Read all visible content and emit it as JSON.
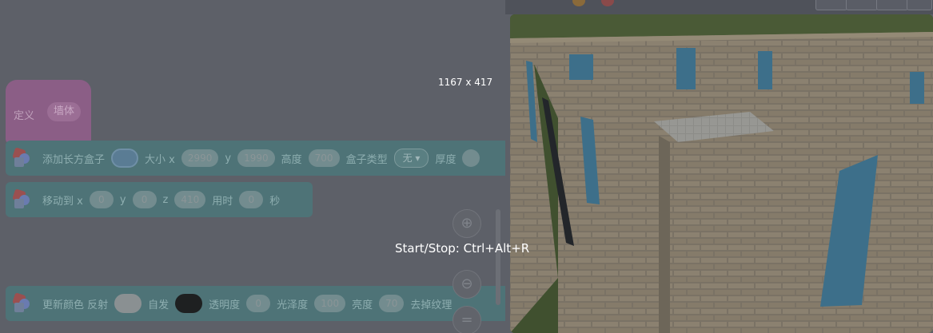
{
  "overlay": {
    "size_label": "1167 x 417",
    "hint_label": "Start/Stop: Ctrl+Alt+R"
  },
  "define_block": {
    "keyword": "定义",
    "name": "墙体"
  },
  "add_box_block": {
    "label": "添加长方盒子",
    "size_label": "大小 x",
    "size_x": "2990",
    "y_label": "y",
    "size_y": "1990",
    "height_label": "高度",
    "height": "700",
    "box_type_label": "盒子类型",
    "box_type": "无",
    "thickness_label": "厚度"
  },
  "move_block": {
    "label": "移动到 x",
    "x": "0",
    "y_label": "y",
    "y": "0",
    "z_label": "z",
    "z": "410",
    "time_label": "用时",
    "time": "0",
    "unit": "秒"
  },
  "color_block": {
    "label": "更新颜色 反射",
    "emissive_label": "自发",
    "opacity_label": "透明度",
    "opacity": "0",
    "gloss_label": "光泽度",
    "gloss": "100",
    "brightness_label": "亮度",
    "brightness": "70",
    "texture_label": "去掉纹理"
  },
  "zoom": {
    "zoom_out_icon": "⊖",
    "reset_icon": "="
  },
  "colors": {
    "reflect_swatch": "#8a9092",
    "emissive_swatch": "#1e2021"
  }
}
